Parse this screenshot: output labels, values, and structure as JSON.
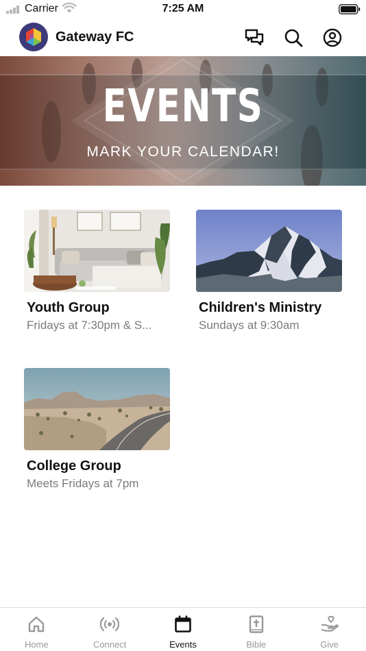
{
  "status_bar": {
    "carrier": "Carrier",
    "time": "7:25 AM"
  },
  "header": {
    "church_name": "Gateway FC",
    "icons": [
      "chat-icon",
      "search-icon",
      "profile-icon"
    ]
  },
  "banner": {
    "title": "EVENTS",
    "subtitle": "MARK YOUR CALENDAR!"
  },
  "events": [
    {
      "title": "Youth Group",
      "subtitle": "Fridays at 7:30pm & S...",
      "image": "living-room"
    },
    {
      "title": "Children's Ministry",
      "subtitle": "Sundays at 9:30am",
      "image": "mountain"
    },
    {
      "title": "College Group",
      "subtitle": "Meets Fridays at 7pm",
      "image": "desert-road"
    }
  ],
  "tabs": [
    {
      "label": "Home",
      "icon": "home-icon",
      "active": false
    },
    {
      "label": "Connect",
      "icon": "broadcast-icon",
      "active": false
    },
    {
      "label": "Events",
      "icon": "calendar-icon",
      "active": true
    },
    {
      "label": "Bible",
      "icon": "bible-icon",
      "active": false
    },
    {
      "label": "Give",
      "icon": "give-icon",
      "active": false
    }
  ],
  "colors": {
    "active_tab": "#111111",
    "inactive_tab": "#999999",
    "logo_bg": "#3c3a78"
  }
}
